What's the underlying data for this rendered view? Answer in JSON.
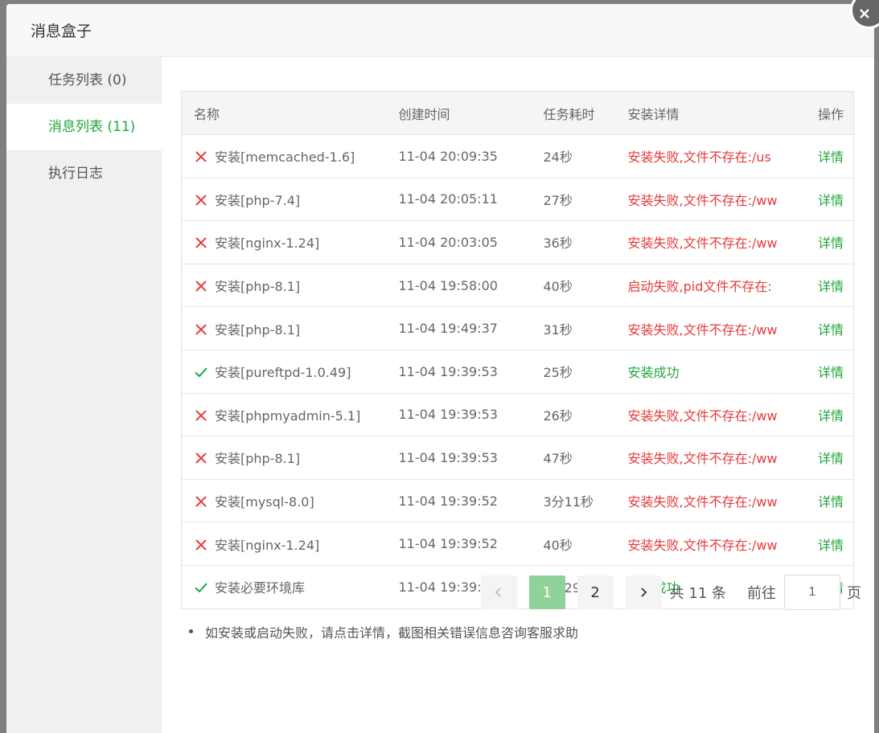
{
  "dialog": {
    "title": "消息盒子"
  },
  "sidebar": {
    "items": [
      {
        "label": "任务列表 (0)"
      },
      {
        "label": "消息列表 (11)"
      },
      {
        "label": "执行日志"
      }
    ]
  },
  "table": {
    "headers": {
      "name": "名称",
      "created": "创建时间",
      "duration": "任务耗时",
      "detail": "安装详情",
      "op": "操作"
    },
    "rows": [
      {
        "status": "fail",
        "name": "安装[memcached-1.6]",
        "created": "11-04 20:09:35",
        "duration": "24秒",
        "detail": "安装失败,文件不存在:/us",
        "op": "详情"
      },
      {
        "status": "fail",
        "name": "安装[php-7.4]",
        "created": "11-04 20:05:11",
        "duration": "27秒",
        "detail": "安装失败,文件不存在:/ww",
        "op": "详情"
      },
      {
        "status": "fail",
        "name": "安装[nginx-1.24]",
        "created": "11-04 20:03:05",
        "duration": "36秒",
        "detail": "安装失败,文件不存在:/ww",
        "op": "详情"
      },
      {
        "status": "fail",
        "name": "安装[php-8.1]",
        "created": "11-04 19:58:00",
        "duration": "40秒",
        "detail": "启动失败,pid文件不存在:",
        "op": "详情"
      },
      {
        "status": "fail",
        "name": "安装[php-8.1]",
        "created": "11-04 19:49:37",
        "duration": "31秒",
        "detail": "安装失败,文件不存在:/ww",
        "op": "详情"
      },
      {
        "status": "ok",
        "name": "安装[pureftpd-1.0.49]",
        "created": "11-04 19:39:53",
        "duration": "25秒",
        "detail": "安装成功",
        "op": "详情"
      },
      {
        "status": "fail",
        "name": "安装[phpmyadmin-5.1]",
        "created": "11-04 19:39:53",
        "duration": "26秒",
        "detail": "安装失败,文件不存在:/ww",
        "op": "详情"
      },
      {
        "status": "fail",
        "name": "安装[php-8.1]",
        "created": "11-04 19:39:53",
        "duration": "47秒",
        "detail": "安装失败,文件不存在:/ww",
        "op": "详情"
      },
      {
        "status": "fail",
        "name": "安装[mysql-8.0]",
        "created": "11-04 19:39:52",
        "duration": "3分11秒",
        "detail": "安装失败,文件不存在:/ww",
        "op": "详情"
      },
      {
        "status": "fail",
        "name": "安装[nginx-1.24]",
        "created": "11-04 19:39:52",
        "duration": "40秒",
        "detail": "安装失败,文件不存在:/ww",
        "op": "详情"
      },
      {
        "status": "ok",
        "name": "安装必要环境库",
        "created": "11-04 19:39:52",
        "duration": "2分29秒",
        "detail": "安装成功",
        "op": "详情"
      }
    ]
  },
  "tips": [
    "如安装或启动失败，请点击详情，截图相关错误信息咨询客服求助"
  ],
  "pagination": {
    "pages": [
      "1",
      "2"
    ],
    "current": "1",
    "total_text": "共 11 条",
    "jump_label": "前往",
    "jump_value": "1",
    "unit": "页"
  },
  "colors": {
    "accent": "#20a53a",
    "error": "#e53b3b"
  }
}
